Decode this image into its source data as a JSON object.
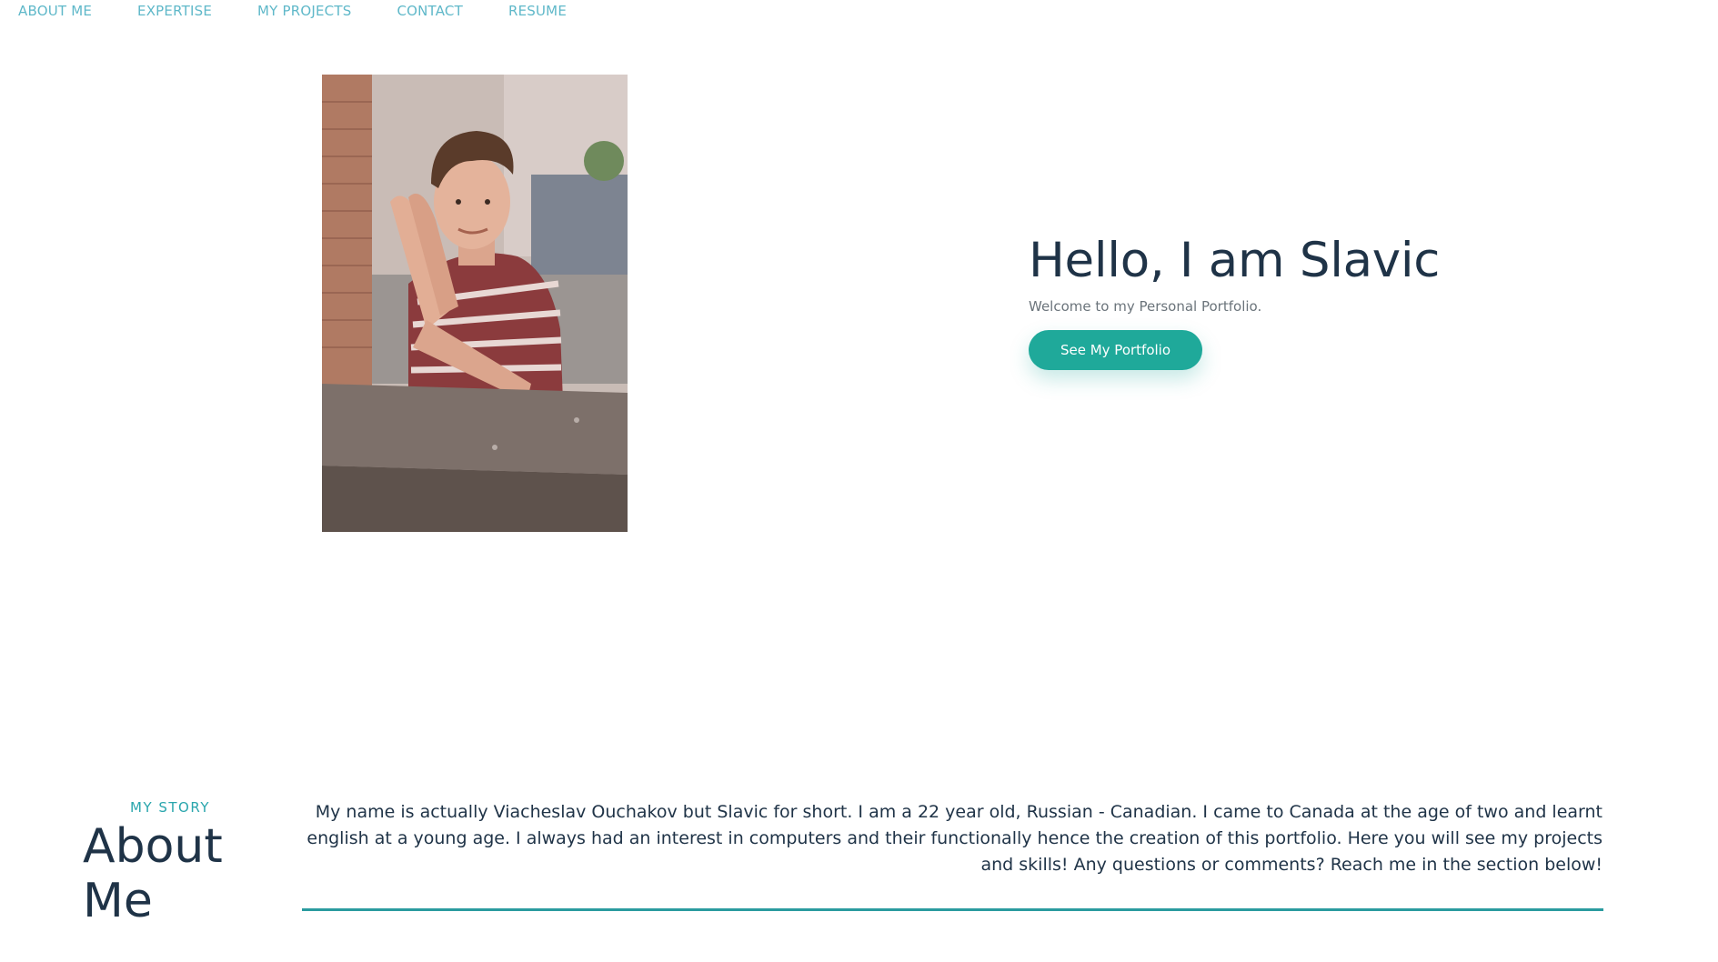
{
  "nav": {
    "items": [
      {
        "label": "ABOUT ME"
      },
      {
        "label": "EXPERTISE"
      },
      {
        "label": "MY PROJECTS"
      },
      {
        "label": "CONTACT"
      },
      {
        "label": "RESUME"
      }
    ]
  },
  "hero": {
    "title": "Hello, I am Slavic",
    "subtitle": "Welcome to my Personal Portfolio.",
    "button_label": "See My Portfolio"
  },
  "about": {
    "eyebrow": "MY STORY",
    "title": "About Me",
    "text": "My name is actually Viacheslav Ouchakov but Slavic for short. I am a 22 year old, Russian - Canadian. I came to Canada at the age of two and learnt english at a young age. I always had an interest in computers and their functionally hence the creation of this portfolio. Here you will see my projects and skills! Any questions or comments? Reach me in the section below!"
  },
  "colors": {
    "nav_link": "#5fb8c9",
    "heading": "#1f3347",
    "accent": "#1fa99a",
    "rule": "#2a9b9f"
  }
}
